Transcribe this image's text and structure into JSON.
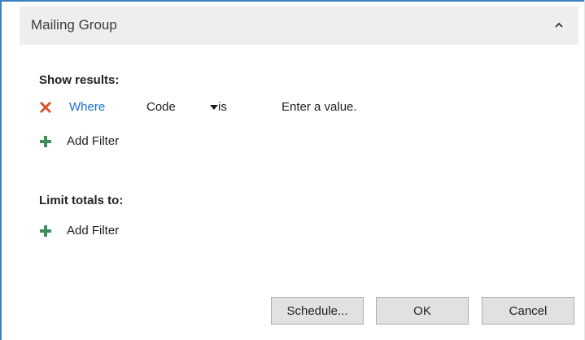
{
  "section": {
    "title": "Mailing Group"
  },
  "show_results": {
    "label": "Show results:",
    "filter": {
      "where_label": "Where",
      "field": "Code",
      "operator": "is",
      "value_placeholder": "Enter a value."
    },
    "add_filter_label": "Add Filter"
  },
  "limit_totals": {
    "label": "Limit totals to:",
    "add_filter_label": "Add Filter"
  },
  "buttons": {
    "schedule": "Schedule...",
    "ok": "OK",
    "cancel": "Cancel"
  },
  "icons": {
    "collapse": "chevron-up-icon",
    "remove": "close-icon",
    "dropdown": "caret-down-icon",
    "add": "plus-icon"
  },
  "colors": {
    "accent_border": "#3d7fc1",
    "link": "#1a6cd6",
    "remove_icon": "#d9532c",
    "add_icon": "#3d8f5a",
    "header_bg": "#eeeeee",
    "button_bg": "#e1e1e1"
  }
}
